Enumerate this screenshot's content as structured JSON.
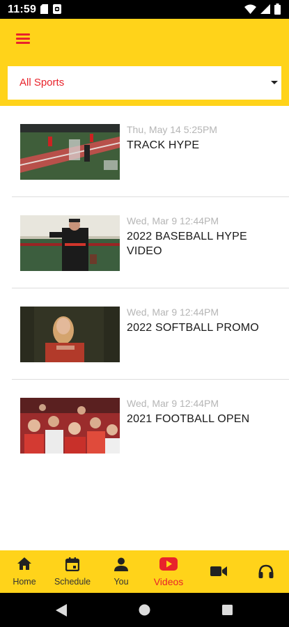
{
  "status_bar": {
    "time": "11:59",
    "left_icons": [
      "sd-card-icon",
      "sync-icon"
    ],
    "right_icons": [
      "wifi-icon",
      "signal-icon",
      "battery-icon"
    ]
  },
  "colors": {
    "accent_yellow": "#ffd31a",
    "brand_red": "#e8232b"
  },
  "app_bar": {
    "menu_icon": "hamburger-menu-icon"
  },
  "filter": {
    "selected": "All Sports"
  },
  "videos": [
    {
      "date": "Thu, May 14 5:25PM",
      "title": "TRACK HYPE"
    },
    {
      "date": "Wed, Mar 9 12:44PM",
      "title": "2022 BASEBALL HYPE VIDEO"
    },
    {
      "date": "Wed, Mar 9 12:44PM",
      "title": "2022 SOFTBALL PROMO"
    },
    {
      "date": "Wed, Mar 9 12:44PM",
      "title": "2021 FOOTBALL OPEN"
    }
  ],
  "bottom_nav": {
    "items": [
      {
        "label": "Home",
        "icon": "home-icon"
      },
      {
        "label": "Schedule",
        "icon": "calendar-icon"
      },
      {
        "label": "You",
        "icon": "person-icon"
      },
      {
        "label": "Videos",
        "icon": "play-video-icon",
        "active": true
      },
      {
        "label": "",
        "icon": "video-camera-icon"
      },
      {
        "label": "",
        "icon": "headphones-icon"
      }
    ]
  },
  "system_nav": {
    "icons": [
      "back-icon",
      "home-circle-icon",
      "recents-icon"
    ]
  }
}
